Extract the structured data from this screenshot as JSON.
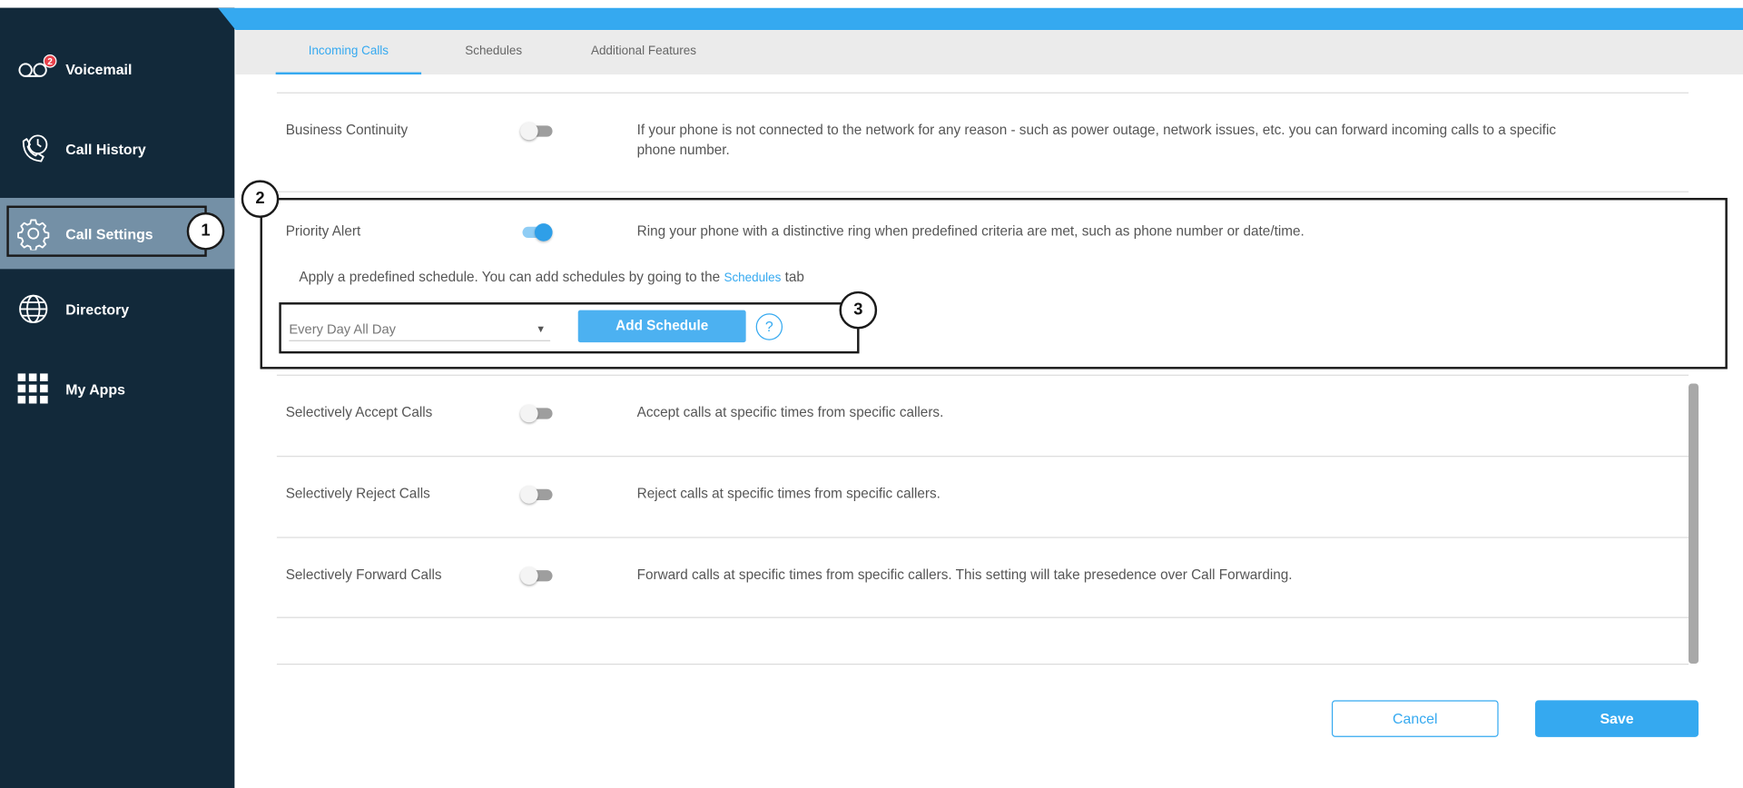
{
  "sidebar": {
    "items": [
      {
        "label": "Voicemail",
        "icon": "voicemail-icon",
        "badge": "2"
      },
      {
        "label": "Call History",
        "icon": "call-history-icon"
      },
      {
        "label": "Call Settings",
        "icon": "gear-icon",
        "active": true
      },
      {
        "label": "Directory",
        "icon": "globe-icon"
      },
      {
        "label": "My Apps",
        "icon": "apps-grid-icon"
      }
    ]
  },
  "tabs": [
    {
      "label": "Incoming Calls",
      "active": true
    },
    {
      "label": "Schedules"
    },
    {
      "label": "Additional Features"
    }
  ],
  "rows": [
    {
      "name": "Business Continuity",
      "toggle_on": false,
      "description": "If your phone is not connected to the network for any reason - such as power outage, network issues, etc. you can forward incoming calls to a specific phone number."
    },
    {
      "name": "Priority Alert",
      "toggle_on": true,
      "description": "Ring your phone with a distinctive ring when predefined criteria are met, such as phone number or date/time."
    },
    {
      "name": "Selectively Accept Calls",
      "toggle_on": false,
      "description": "Accept calls at specific times from specific callers."
    },
    {
      "name": "Selectively Reject Calls",
      "toggle_on": false,
      "description": "Reject calls at specific times from specific callers."
    },
    {
      "name": "Selectively Forward Calls",
      "toggle_on": false,
      "description": "Forward calls at specific times from specific callers. This setting will take presedence over Call Forwarding."
    }
  ],
  "priority_alert": {
    "schedule_note": "Apply a predefined schedule. You can add schedules by going to the",
    "schedule_link": "Schedules",
    "schedule_note_suffix": "tab",
    "schedule_select_value": "Every Day All Day",
    "add_schedule_label": "Add Schedule",
    "help_label": "?"
  },
  "callouts": [
    "1",
    "2",
    "3"
  ],
  "footer": {
    "cancel_label": "Cancel",
    "save_label": "Save"
  },
  "colors": {
    "accent": "#35a9f0",
    "sidebar_bg": "#12293a",
    "sidebar_active": "#7490a6",
    "badge": "#e8414b"
  }
}
